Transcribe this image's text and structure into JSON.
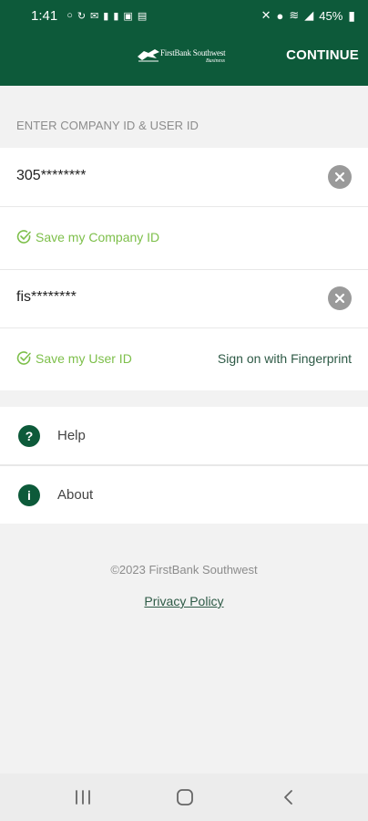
{
  "status_bar": {
    "time": "1:41",
    "battery": "45%"
  },
  "header": {
    "logo_text": "FirstBank Southwest",
    "logo_subtext": "Business",
    "continue_label": "CONTINUE"
  },
  "login": {
    "section_label": "ENTER COMPANY ID & USER ID",
    "company_id_value": "305********",
    "save_company_label": "Save my Company ID",
    "user_id_value": "fis********",
    "save_user_label": "Save my User ID",
    "fingerprint_label": "Sign on with Fingerprint"
  },
  "menu": {
    "items": [
      {
        "label": "Help",
        "icon": "?"
      },
      {
        "label": "About",
        "icon": "i"
      }
    ]
  },
  "footer": {
    "copyright": "©2023 FirstBank Southwest",
    "privacy_label": "Privacy Policy"
  },
  "colors": {
    "brand_green": "#0d5a3a",
    "check_green": "#7dbf4a"
  }
}
